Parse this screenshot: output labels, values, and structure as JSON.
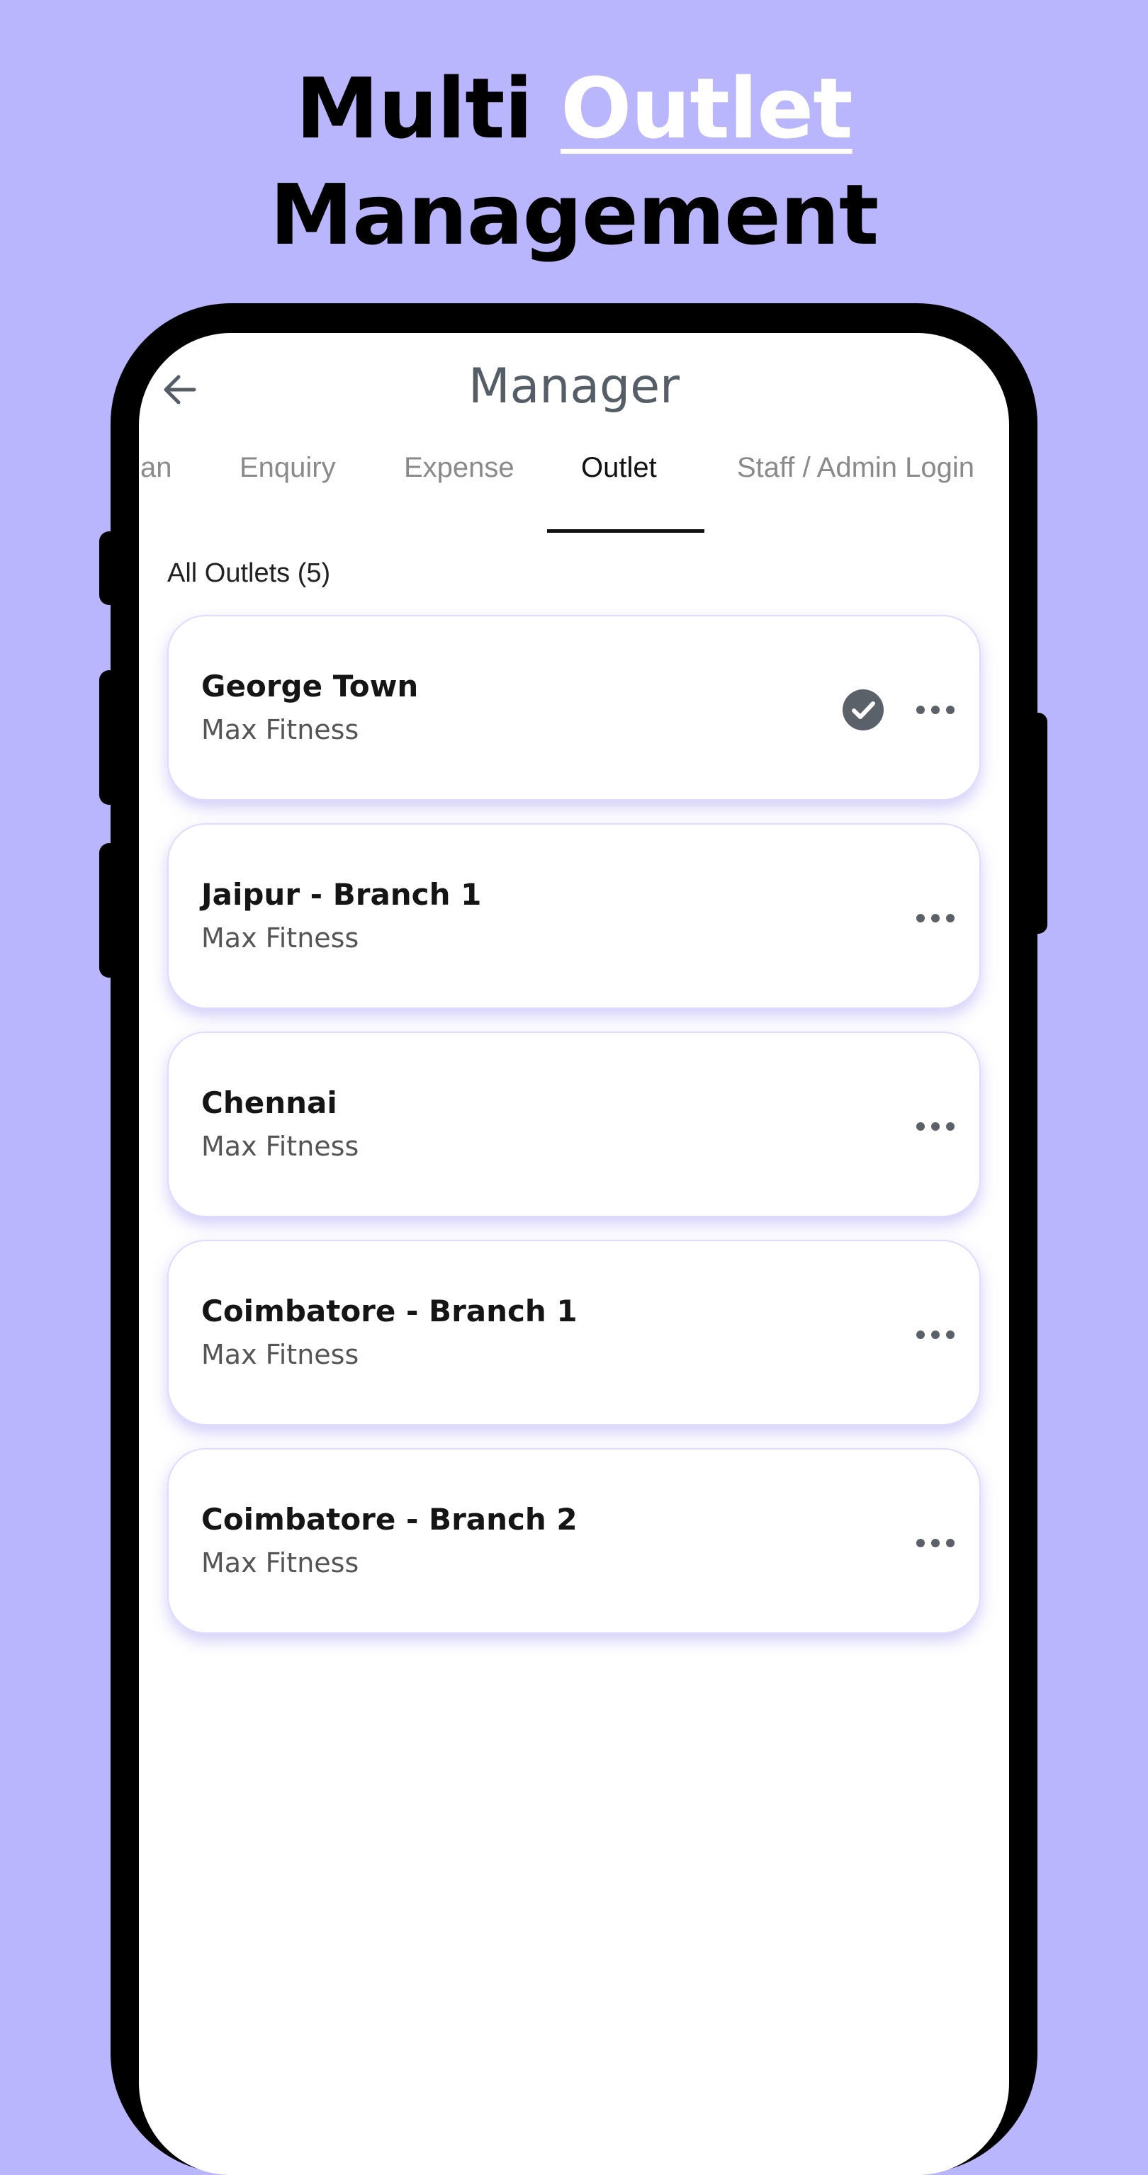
{
  "headline": {
    "line1_prefix": "Multi",
    "line1_accent": "Outlet",
    "line2": "Management"
  },
  "colors": {
    "background": "#b9b6fd",
    "accent_text": "#ffffff",
    "check_badge": "#5a6168",
    "title": "#555d66"
  },
  "app": {
    "title": "Manager",
    "back_icon": "arrow-left-icon",
    "tabs": [
      {
        "label": "an",
        "active": false
      },
      {
        "label": "Enquiry",
        "active": false
      },
      {
        "label": "Expense",
        "active": false
      },
      {
        "label": "Outlet",
        "active": true
      },
      {
        "label": "Staff / Admin Login",
        "active": false
      }
    ],
    "section_label": "All Outlets (5)",
    "outlets": [
      {
        "name": "George Town",
        "brand": "Max Fitness",
        "selected": true
      },
      {
        "name": "Jaipur - Branch 1",
        "brand": "Max Fitness",
        "selected": false
      },
      {
        "name": "Chennai",
        "brand": "Max Fitness",
        "selected": false
      },
      {
        "name": "Coimbatore - Branch 1",
        "brand": "Max Fitness",
        "selected": false
      },
      {
        "name": "Coimbatore - Branch 2",
        "brand": "Max Fitness",
        "selected": false
      }
    ],
    "more_icon": "more-horizontal-icon",
    "selected_icon": "check-circle-icon"
  }
}
